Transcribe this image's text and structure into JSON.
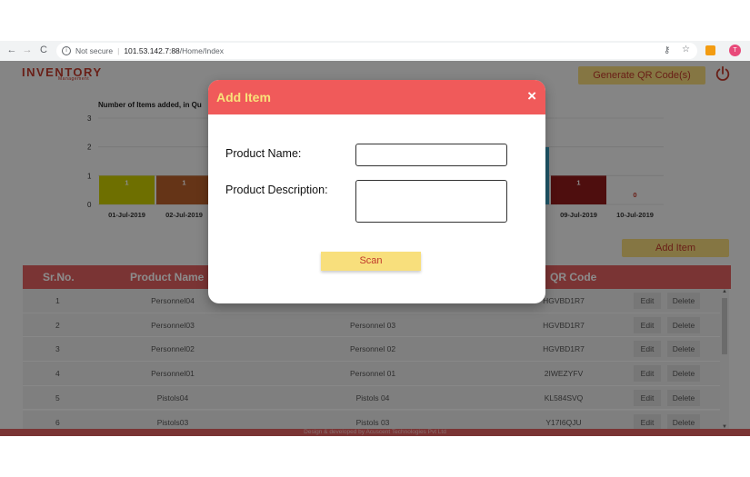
{
  "browser": {
    "security_label": "Not secure",
    "url_host": "101.53.142.7:88",
    "url_path": "/Home/Index",
    "profile_initial": "T"
  },
  "app": {
    "logo_title": "INVENTORY",
    "logo_subtitle": "Management",
    "generate_qr_label": "Generate QR Code(s)",
    "add_item_label": "Add Item",
    "footer_text": "Design & developed by Acuscent Technologies Pvt Ltd"
  },
  "chart_data": {
    "type": "bar",
    "title": "Number of Items added, in Qu",
    "ylim": [
      0,
      3
    ],
    "yticks": [
      "3",
      "2",
      "1",
      "0"
    ],
    "categories": [
      "01-Jul-2019",
      "02-Jul-2019",
      "09-Jul-2019",
      "10-Jul-2019"
    ],
    "values": [
      1,
      1,
      1,
      0
    ],
    "colors": [
      "#c8cb00",
      "#b8602a",
      "#8e1b1b",
      "#d99a2b"
    ]
  },
  "table": {
    "headers": [
      "Sr.No.",
      "Product Name",
      "QR Code"
    ],
    "rows": [
      {
        "sr": "1",
        "name": "Personnel04",
        "desc": "",
        "qr": "HGVBD1R7"
      },
      {
        "sr": "2",
        "name": "Personnel03",
        "desc": "Personnel 03",
        "qr": "HGVBD1R7"
      },
      {
        "sr": "3",
        "name": "Personnel02",
        "desc": "Personnel 02",
        "qr": "HGVBD1R7"
      },
      {
        "sr": "4",
        "name": "Personnel01",
        "desc": "Personnel 01",
        "qr": "2IWEZYFV"
      },
      {
        "sr": "5",
        "name": "Pistols04",
        "desc": "Pistols 04",
        "qr": "KL584SVQ"
      },
      {
        "sr": "6",
        "name": "Pistols03",
        "desc": "Pistols 03",
        "qr": "Y17I6QJU"
      }
    ],
    "edit_label": "Edit",
    "delete_label": "Delete"
  },
  "modal": {
    "title": "Add Item",
    "close_symbol": "×",
    "product_name_label": "Product Name:",
    "product_desc_label": "Product Description:",
    "product_name_value": "",
    "product_desc_value": "",
    "scan_label": "Scan"
  }
}
